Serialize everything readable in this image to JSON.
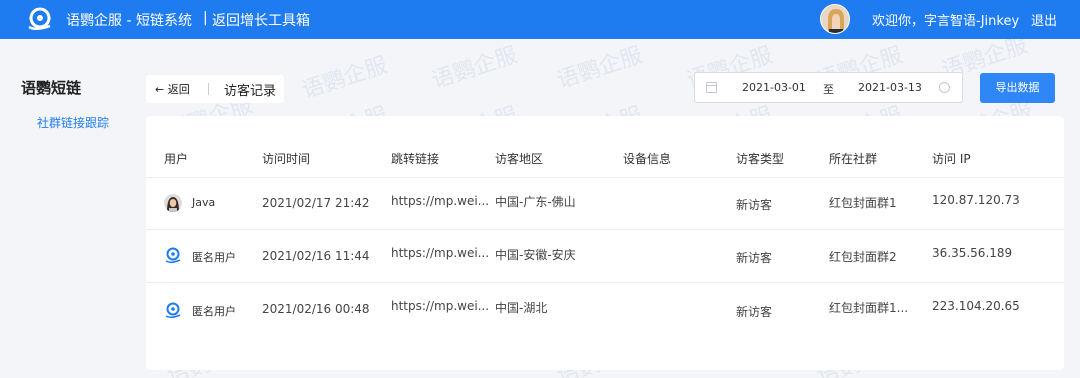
{
  "topbar": {
    "app_title": "语鹦企服 - 短链系统",
    "separator": "|",
    "back_tool_label": "返回增长工具箱",
    "welcome": "欢迎你，字言智语-Jinkey",
    "logout_label": "退出"
  },
  "sidebar": {
    "title": "语鹦短链",
    "items": [
      {
        "label": "社群链接跟踪"
      }
    ]
  },
  "header": {
    "back_label": "返回",
    "page_title": "访客记录"
  },
  "date_range": {
    "start": "2021-03-01",
    "to": "至",
    "end": "2021-03-13"
  },
  "export_label": "导出数据",
  "table": {
    "columns": [
      "用户",
      "访问时间",
      "跳转链接",
      "访客地区",
      "设备信息",
      "访客类型",
      "所在社群",
      "访问 IP"
    ],
    "rows": [
      {
        "user": "Java",
        "avatar": "photo",
        "time": "2021/02/17 21:42",
        "link": "https://mp.wei...",
        "region": "中国-广东-佛山",
        "device": "",
        "type": "新访客",
        "group": "红包封面群1",
        "ip": "120.87.120.73"
      },
      {
        "user": "匿名用户",
        "avatar": "logo",
        "time": "2021/02/16 11:44",
        "link": "https://mp.wei...",
        "region": "中国-安徽-安庆",
        "device": "",
        "type": "新访客",
        "group": "红包封面群2",
        "ip": "36.35.56.189"
      },
      {
        "user": "匿名用户",
        "avatar": "logo",
        "time": "2021/02/16 00:48",
        "link": "https://mp.wei...",
        "region": "中国-湖北",
        "device": "",
        "type": "新访客",
        "group": "红包封面群1...",
        "ip": "223.104.20.65"
      }
    ]
  },
  "watermark": "语鹦企服",
  "colors": {
    "brand": "#1f7cf0",
    "button": "#2f86f6"
  }
}
